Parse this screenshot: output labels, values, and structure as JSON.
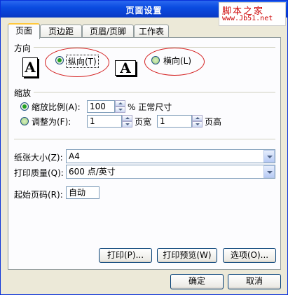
{
  "window": {
    "title": "页面设置"
  },
  "watermark": {
    "title": "脚本之家",
    "url": "www.Jb51.net"
  },
  "tabs": [
    {
      "label": "页面",
      "active": true
    },
    {
      "label": "页边距",
      "active": false
    },
    {
      "label": "页眉/页脚",
      "active": false
    },
    {
      "label": "工作表",
      "active": false
    }
  ],
  "orientation": {
    "heading": "方向",
    "portrait_label": "纵向(T)",
    "landscape_label": "横向(L)",
    "icon_glyph": "A",
    "selected": "portrait"
  },
  "scaling": {
    "heading": "缩放",
    "adjust_label": "缩放比例(A):",
    "adjust_value": "100",
    "adjust_suffix": "% 正常尺寸",
    "fit_label": "调整为(F):",
    "fit_wide_value": "1",
    "fit_wide_suffix": "页宽",
    "fit_tall_value": "1",
    "fit_tall_suffix": "页高",
    "selected": "adjust"
  },
  "paper_size": {
    "label": "纸张大小(Z):",
    "value": "A4"
  },
  "print_quality": {
    "label": "打印质量(Q):",
    "value": "600 点/英寸"
  },
  "first_page": {
    "label": "起始页码(R):",
    "value": "自动"
  },
  "buttons": {
    "print": "打印(P)...",
    "preview": "打印预览(W)",
    "options": "选项(O)...",
    "ok": "确定",
    "cancel": "取消"
  },
  "colors": {
    "title_bar": "#0a4be0",
    "annotation": "#d42020",
    "radio_selected": "#21a121"
  }
}
